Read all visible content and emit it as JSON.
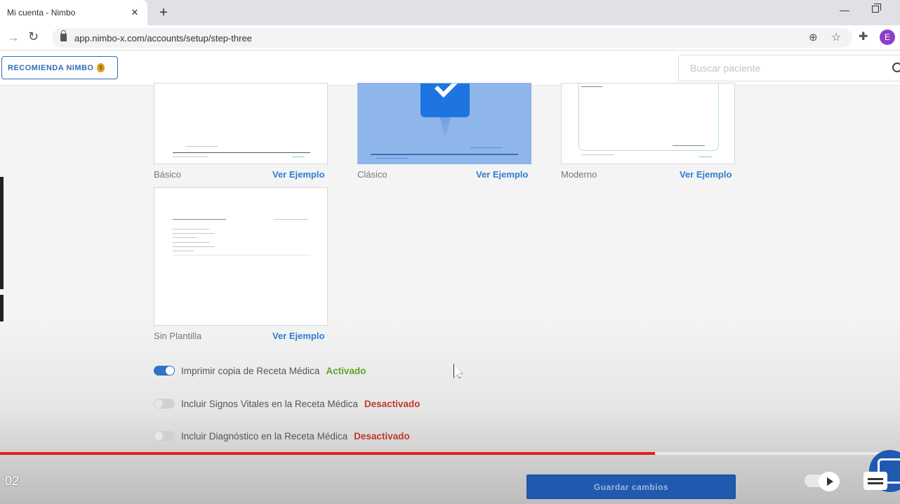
{
  "browser": {
    "tab_title": "Mi cuenta - Nimbo",
    "url": "app.nimbo-x.com/accounts/setup/step-three",
    "profile_initial": "E"
  },
  "header": {
    "recommend_label": "RECOMIENDA NIMBO",
    "search_placeholder": "Buscar paciente"
  },
  "templates": [
    {
      "name": "Básico",
      "link": "Ver Ejemplo"
    },
    {
      "name": "Clásico",
      "link": "Ver Ejemplo",
      "selected": true
    },
    {
      "name": "Moderno",
      "link": "Ver Ejemplo"
    },
    {
      "name": "Sin Plantilla",
      "link": "Ver Ejemplo"
    }
  ],
  "options": [
    {
      "label": "Imprimir copia de Receta Médica",
      "status": "Activado",
      "on": true
    },
    {
      "label": "Incluir Signos Vitales en la Receta Médica",
      "status": "Desactivado",
      "on": false
    },
    {
      "label": "Incluir Diagnóstico en la Receta Médica",
      "status": "Desactivado",
      "on": false
    }
  ],
  "footer": {
    "save_label": "Guardar cambios"
  },
  "video": {
    "time": ":02",
    "progress": 0.728
  },
  "colors": {
    "accent": "#2f7fd0",
    "active": "#62a02c",
    "inactive": "#c0392b",
    "progress": "#e32020"
  }
}
